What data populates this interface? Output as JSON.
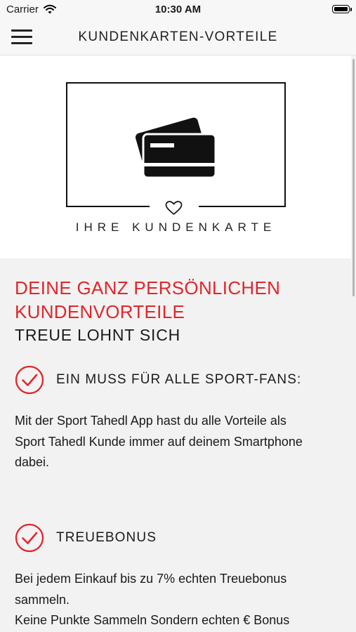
{
  "status": {
    "carrier": "Carrier",
    "time": "10:30 AM"
  },
  "nav": {
    "title": "KUNDENKARTEN-VORTEILE",
    "menu_icon": "hamburger-menu-icon"
  },
  "hero": {
    "caption": "IHRE KUNDENKARTE",
    "icon": "credit-cards-icon",
    "heart_icon": "heart-icon"
  },
  "content": {
    "headline_line1": "DEINE GANZ PERSÖNLICHEN",
    "headline_line2": "KUNDENVORTEILE",
    "subheadline": "TREUE LOHNT SICH"
  },
  "features": [
    {
      "title": "EIN MUSS FÜR ALLE SPORT-FANS:",
      "icon": "check-circle-icon",
      "lines": [
        "Mit der Sport Tahedl App hast du alle Vorteile als",
        "Sport Tahedl Kunde immer auf deinem Smartphone",
        "dabei."
      ]
    },
    {
      "title": "TREUEBONUS",
      "icon": "check-circle-icon",
      "lines": [
        "Bei jedem Einkauf bis zu 7% echten Treuebonus",
        "sammeln.",
        "Keine Punkte Sammeln Sondern echten € Bonus"
      ]
    }
  ],
  "colors": {
    "accent": "#e0262b",
    "text": "#1a1a1a",
    "background": "#f2f2f2"
  }
}
